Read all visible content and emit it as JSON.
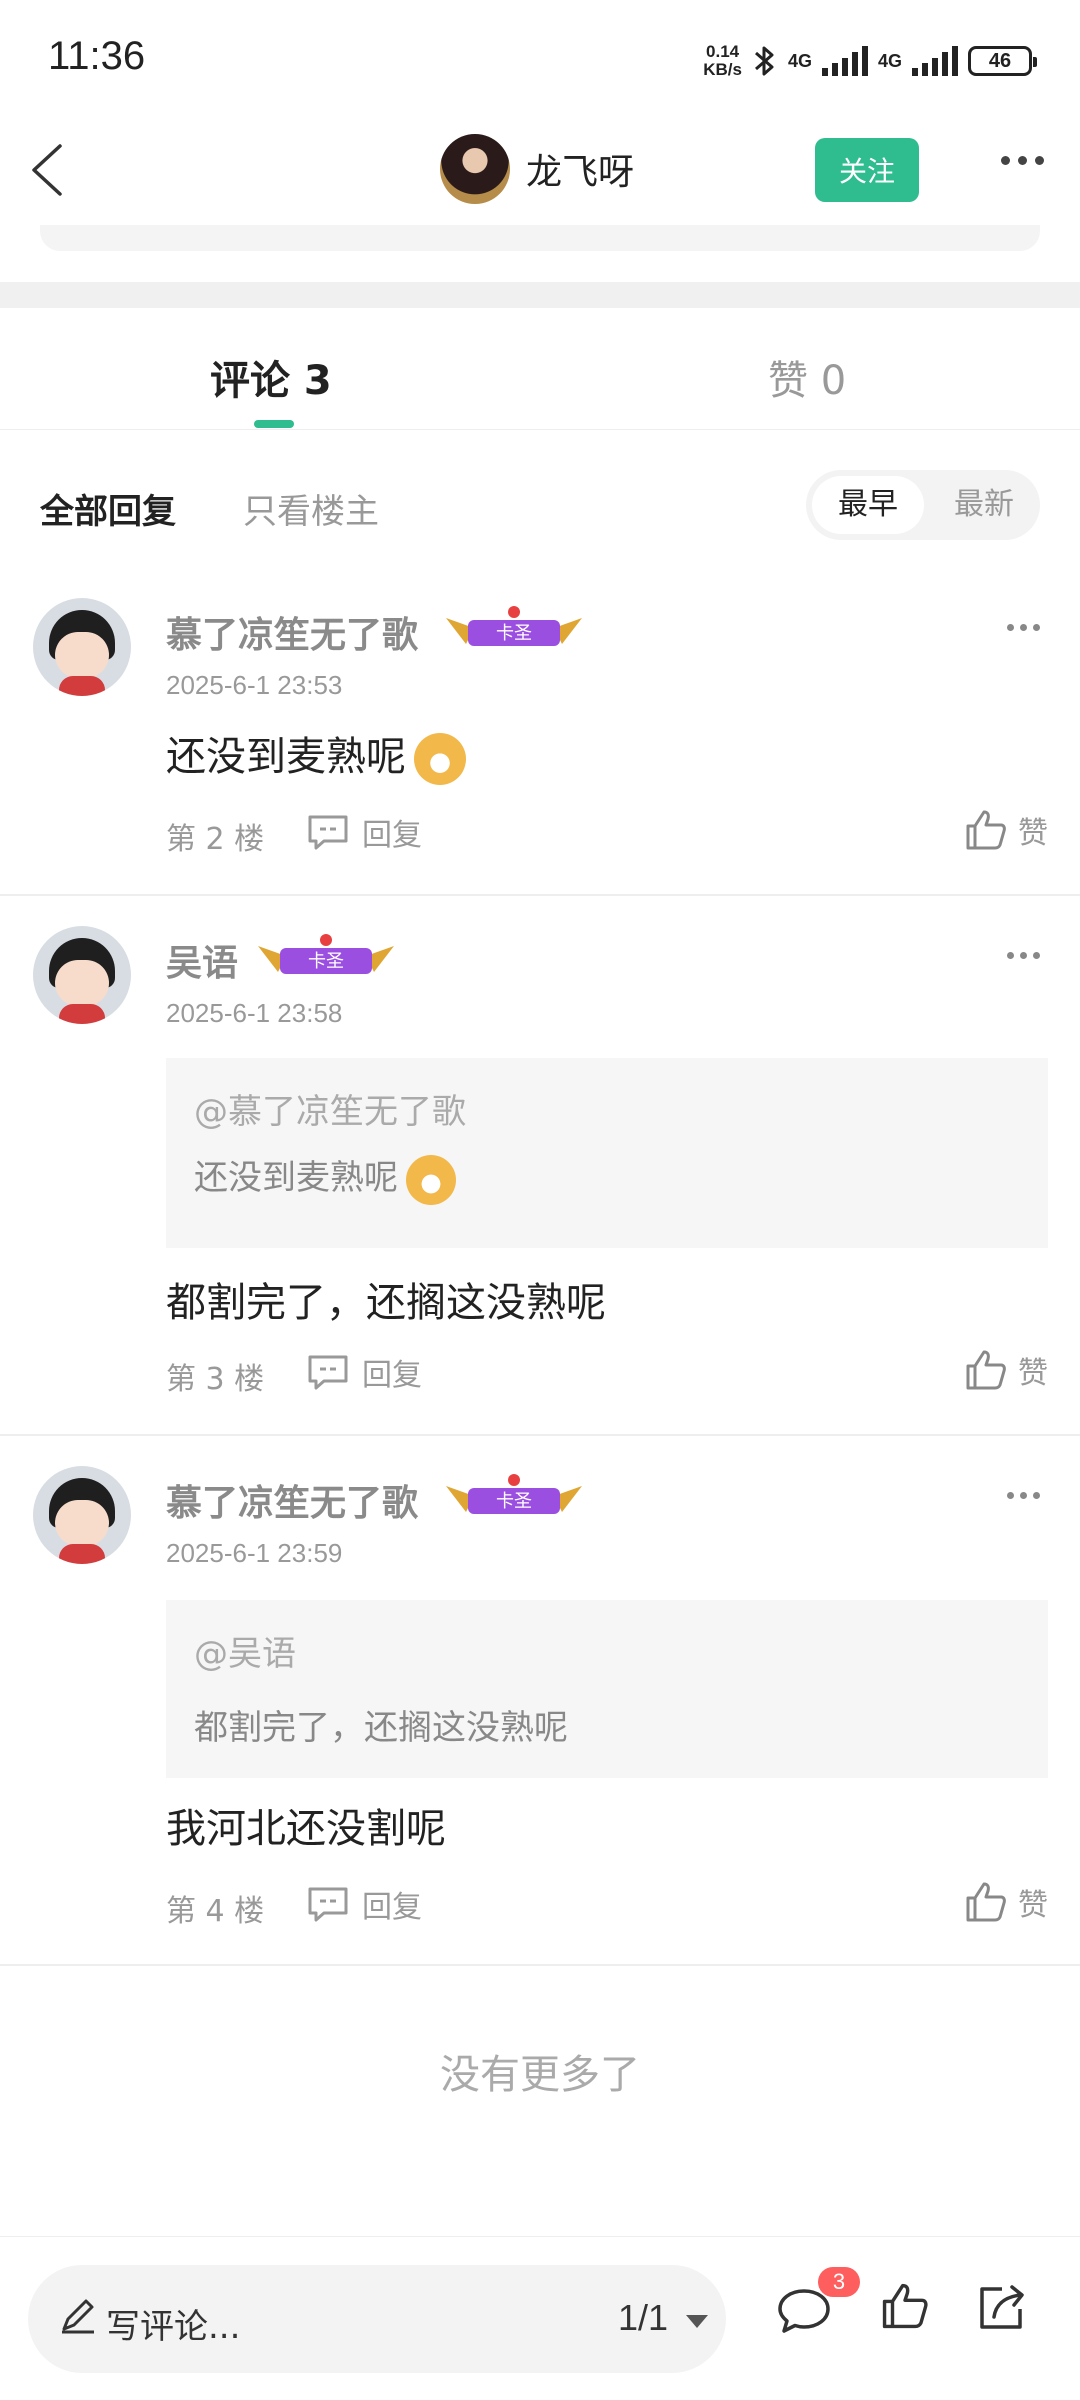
{
  "status_bar": {
    "time": "11:36",
    "speed_value": "0.14",
    "speed_unit": "KB/s",
    "net1": "4G",
    "net2": "4G",
    "battery": "46"
  },
  "nav": {
    "username": "龙飞呀",
    "follow_label": "关注"
  },
  "tabs": {
    "comments_label": "评论 3",
    "likes_label": "赞 0"
  },
  "filter": {
    "all_label": "全部回复",
    "owner_label": "只看楼主",
    "sort_early": "最早",
    "sort_new": "最新"
  },
  "badge_label": "卡圣",
  "reply_label": "回复",
  "like_label": "赞",
  "comments": [
    {
      "name": "慕了凉笙无了歌",
      "time": "2025-6-1 23:53",
      "text": "还没到麦熟呢",
      "floor": "第 2 楼"
    },
    {
      "name": "吴语",
      "time": "2025-6-1 23:58",
      "quote_at": "@慕了凉笙无了歌",
      "quote_text": "还没到麦熟呢",
      "text": "都割完了，还搁这没熟呢",
      "floor": "第 3 楼"
    },
    {
      "name": "慕了凉笙无了歌",
      "time": "2025-6-1 23:59",
      "quote_at": "@吴语",
      "quote_text": "都割完了，还搁这没熟呢",
      "text": "我河北还没割呢",
      "floor": "第 4 楼"
    }
  ],
  "no_more": "没有更多了",
  "bottom": {
    "placeholder": "写评论...",
    "page": "1/1",
    "comment_count": "3"
  },
  "colors": {
    "accent": "#2fbc8e",
    "badge_red": "#ff5e5e",
    "badge_purple": "#9b4fe0"
  }
}
